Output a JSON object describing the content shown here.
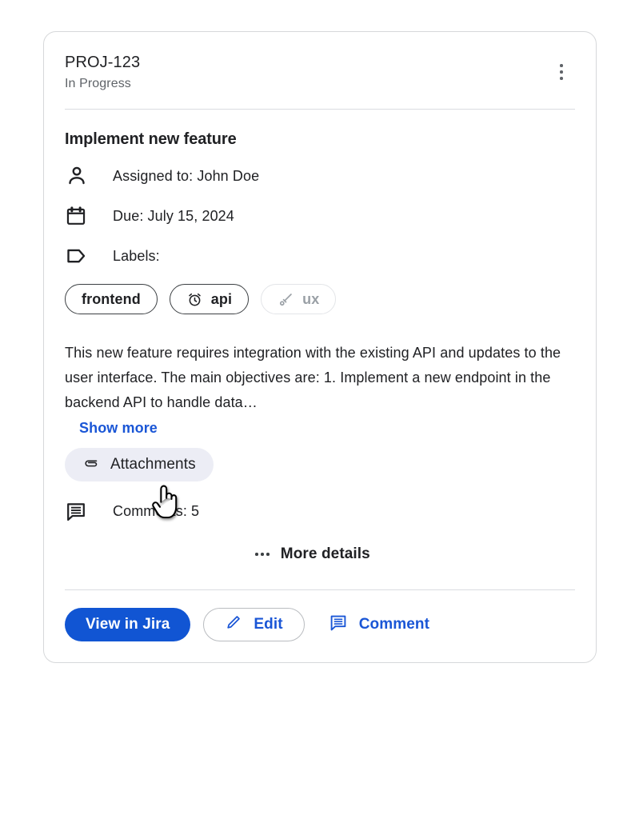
{
  "card": {
    "issue_key": "PROJ-123",
    "status": "In Progress",
    "menu_icon": "kebab-menu-icon",
    "task_title": "Implement new feature",
    "meta": [
      {
        "icon": "person-icon",
        "text": "Assigned to: John Doe"
      },
      {
        "icon": "calendar-icon",
        "text": "Due: July 15, 2024"
      },
      {
        "icon": "tag-icon",
        "text": "Labels:"
      }
    ],
    "chips": [
      {
        "label": "frontend",
        "icon": null,
        "disabled": false
      },
      {
        "label": "api",
        "icon": "alarm-clock-icon",
        "disabled": false
      },
      {
        "label": "ux",
        "icon": "brush-icon",
        "disabled": true
      }
    ],
    "description": "This new feature requires integration with the existing API and updates to the user interface. The main objectives are: 1. Implement a new endpoint in the backend API to handle data…",
    "show_more_label": "Show more",
    "attachments": {
      "label": "Attachments",
      "icon": "paperclip-icon",
      "background": "#ecedf5"
    },
    "comments": {
      "icon": "comment-bubble-icon",
      "text": "Comments: 5"
    },
    "more_details": {
      "icon": "ellipsis-icon",
      "label": "More details"
    },
    "footer": {
      "primary_button": {
        "label": "View in Jira",
        "color": "#1155d3"
      },
      "outline_button": {
        "label": "Edit",
        "icon": "pencil-icon",
        "color": "#1a56d6"
      },
      "text_button": {
        "label": "Comment",
        "icon": "comment-bubble-icon",
        "color": "#1a56d6"
      }
    },
    "cursor": {
      "icon": "pointing-hand-cursor"
    }
  },
  "colors": {
    "accent_blue": "#1155d3",
    "link_blue": "#1a56d6",
    "text_primary": "#202124",
    "text_secondary": "#5f6368",
    "border": "#dadce0",
    "chip_disabled": "#9aa0a6",
    "page_background": "#ffffff"
  }
}
